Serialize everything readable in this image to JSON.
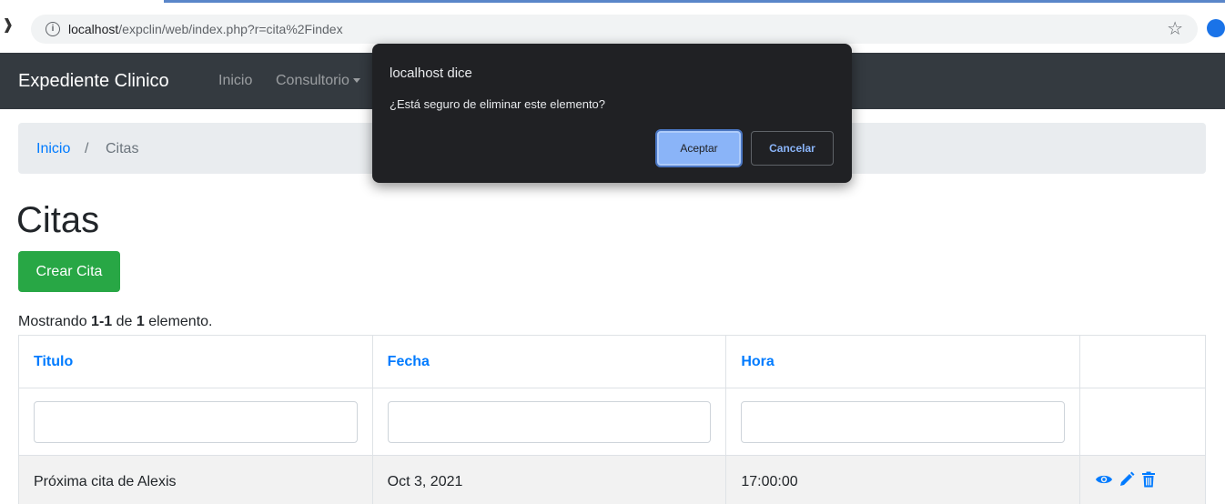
{
  "browser": {
    "url_host": "localhost",
    "url_path": "/expclin/web/index.php?r=cita%2Findex",
    "edge_glyph": "❱"
  },
  "navbar": {
    "brand": "Expediente Clinico",
    "links": [
      {
        "label": "Inicio"
      },
      {
        "label": "Consultorio"
      }
    ]
  },
  "breadcrumb": {
    "home": "Inicio",
    "separator": "/",
    "current": "Citas"
  },
  "page": {
    "title": "Citas",
    "create_button": "Crear Cita"
  },
  "summary": {
    "prefix": "Mostrando ",
    "range": "1-1",
    "middle": " de ",
    "total": "1",
    "suffix": " elemento."
  },
  "table": {
    "columns": [
      "Titulo",
      "Fecha",
      "Hora",
      ""
    ],
    "rows": [
      {
        "titulo": "Próxima cita de Alexis",
        "fecha": "Oct 3, 2021",
        "hora": "17:00:00"
      }
    ]
  },
  "dialog": {
    "title": "localhost dice",
    "message": "¿Está seguro de eliminar este elemento?",
    "ok_label": "Aceptar",
    "cancel_label": "Cancelar"
  },
  "colors": {
    "navbar_bg": "#343a40",
    "link": "#007bff",
    "success": "#28a745",
    "dialog_bg": "#202124",
    "dialog_accent": "#8ab4f8"
  },
  "icons": [
    "info-icon",
    "star-icon",
    "extension-icon",
    "eye-icon",
    "pencil-icon",
    "trash-icon",
    "caret-down-icon"
  ]
}
